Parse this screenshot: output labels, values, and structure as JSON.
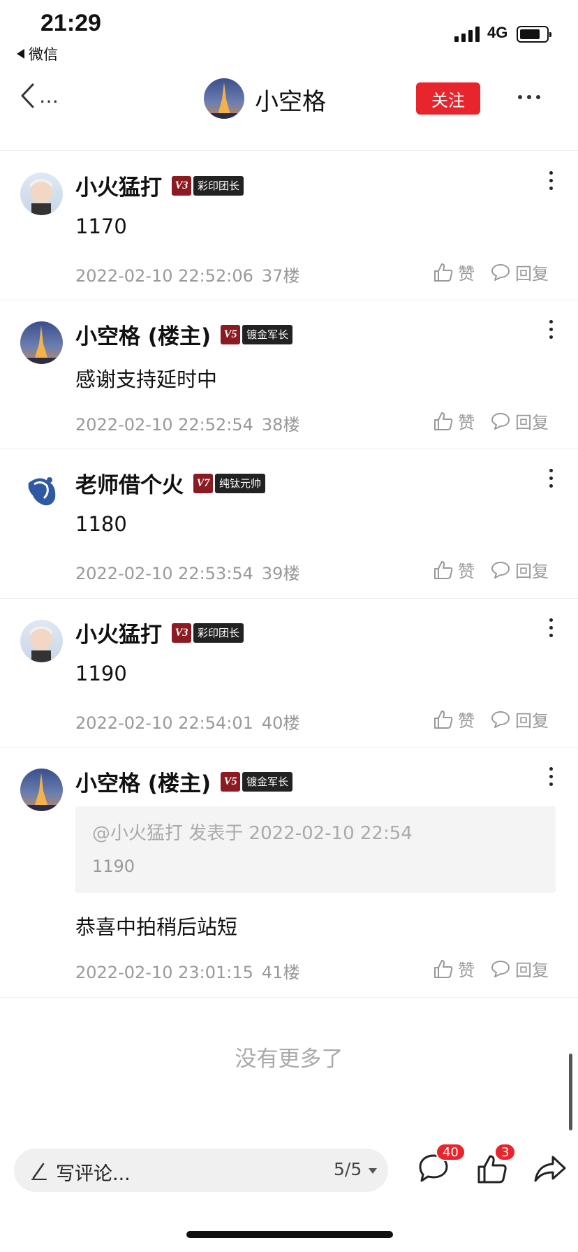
{
  "status_bar": {
    "time": "21:29",
    "back_app": "微信",
    "network": "4G"
  },
  "nav": {
    "title": "小空格",
    "follow_label": "关注"
  },
  "comments": [
    {
      "name": "小火猛打",
      "level": "V3",
      "rank": "彩印团长",
      "text": "1170",
      "time": "2022-02-10 22:52:06",
      "floor": "37楼"
    },
    {
      "name": "小空格 (楼主)",
      "level": "V5",
      "rank": "镀金军长",
      "text": "感谢支持延时中",
      "time": "2022-02-10 22:52:54",
      "floor": "38楼"
    },
    {
      "name": "老师借个火",
      "level": "V7",
      "rank": "纯钛元帅",
      "text": "1180",
      "time": "2022-02-10 22:53:54",
      "floor": "39楼"
    },
    {
      "name": "小火猛打",
      "level": "V3",
      "rank": "彩印团长",
      "text": "1190",
      "time": "2022-02-10 22:54:01",
      "floor": "40楼"
    },
    {
      "name": "小空格 (楼主)",
      "level": "V5",
      "rank": "镀金军长",
      "quote_header": "@小火猛打 发表于 2022-02-10 22:54",
      "quote_text": "1190",
      "text": "恭喜中拍稍后站短",
      "time": "2022-02-10 23:01:15",
      "floor": "41楼"
    }
  ],
  "actions": {
    "like_label": "赞",
    "reply_label": "回复"
  },
  "footer": {
    "no_more": "没有更多了"
  },
  "bottom_bar": {
    "placeholder": "写评论...",
    "page": "5/5",
    "comment_count": "40",
    "like_count": "3"
  },
  "colors": {
    "accent": "#e8242c",
    "level_badge": "#8b1a22",
    "rank_badge": "#222222"
  }
}
